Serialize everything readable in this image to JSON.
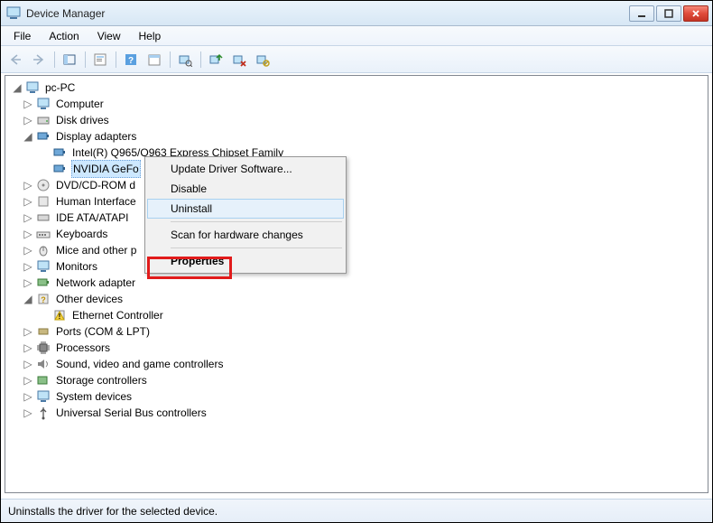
{
  "window": {
    "title": "Device Manager"
  },
  "menus": {
    "file": "File",
    "action": "Action",
    "view": "View",
    "help": "Help"
  },
  "tree": {
    "root": "pc-PC",
    "computer": "Computer",
    "disk_drives": "Disk drives",
    "display_adapters": "Display adapters",
    "display_intel": "Intel(R)  Q965/Q963 Express Chipset Family",
    "display_nvidia": "NVIDIA GeFo",
    "dvd": "DVD/CD-ROM d",
    "hid": "Human Interface",
    "ide": "IDE ATA/ATAPI",
    "keyboards": "Keyboards",
    "mice": "Mice and other p",
    "monitors": "Monitors",
    "network": "Network adapter",
    "other": "Other devices",
    "other_eth": "Ethernet Controller",
    "ports": "Ports (COM & LPT)",
    "processors": "Processors",
    "sound": "Sound, video and game controllers",
    "storage": "Storage controllers",
    "system": "System devices",
    "usb": "Universal Serial Bus controllers"
  },
  "context_menu": {
    "update": "Update Driver Software...",
    "disable": "Disable",
    "uninstall": "Uninstall",
    "scan": "Scan for hardware changes",
    "properties": "Properties"
  },
  "status": {
    "text": "Uninstalls the driver for the selected device."
  }
}
